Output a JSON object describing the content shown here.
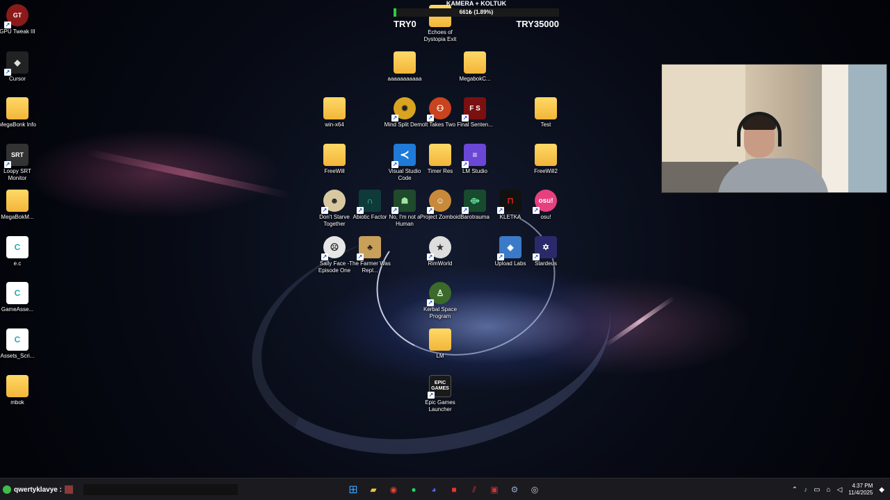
{
  "tracker": {
    "title": "KAMERA + KOLTUK",
    "value_text": "661₺ (1.89%)",
    "progress_percent": 1.89,
    "min_label": "TRY0",
    "max_label": "TRY35000"
  },
  "desktop": {
    "left_column": [
      {
        "label": "GPU Tweak III"
      },
      {
        "label": "Cursor"
      },
      {
        "label": "MegaBonk Info"
      },
      {
        "label": "Loopy SRT Monitor",
        "badge": "SRT"
      },
      {
        "label": "MegaBokM..."
      },
      {
        "label": "e.c",
        "glyph": "C"
      },
      {
        "label": "GameAsse...",
        "glyph": "C"
      },
      {
        "label": "Assets_Scri...",
        "glyph": "C"
      },
      {
        "label": "mbok"
      }
    ],
    "grid": [
      {
        "label": "Echoes of Dystopia Exit"
      },
      {
        "label": "aaaaaaaaaaa"
      },
      {
        "label": "MegabokC..."
      },
      {
        "label": "win-x64"
      },
      {
        "label": "Mind Split Demo"
      },
      {
        "label": "It Takes Two"
      },
      {
        "label": "Final Senten...",
        "glyph": "F S"
      },
      {
        "label": "Test"
      },
      {
        "label": "FreeWill"
      },
      {
        "label": "Visual Studio Code"
      },
      {
        "label": "Timer Res"
      },
      {
        "label": "LM Studio"
      },
      {
        "label": "FreeWill2"
      },
      {
        "label": "Don't Starve Together"
      },
      {
        "label": "Abiotic Factor"
      },
      {
        "label": "No, I'm not a Human"
      },
      {
        "label": "Project Zomboid"
      },
      {
        "label": "Barotrauma"
      },
      {
        "label": "KLETKA"
      },
      {
        "label": "osu!",
        "glyph": "osu!"
      },
      {
        "label": "Sally Face - Episode One"
      },
      {
        "label": "The Farmer Was Repl..."
      },
      {
        "label": "RimWorld"
      },
      {
        "label": "Upload Labs"
      },
      {
        "label": "Stardeus"
      },
      {
        "label": "Kerbal Space Program"
      },
      {
        "label": "LM"
      },
      {
        "label": "Epic Games Launcher",
        "glyph": "EPIC GAMES"
      }
    ]
  },
  "taskbar": {
    "user_label": "qwertyklavye :",
    "clock_time": "4:37 PM",
    "clock_date": "11/4/2025"
  }
}
